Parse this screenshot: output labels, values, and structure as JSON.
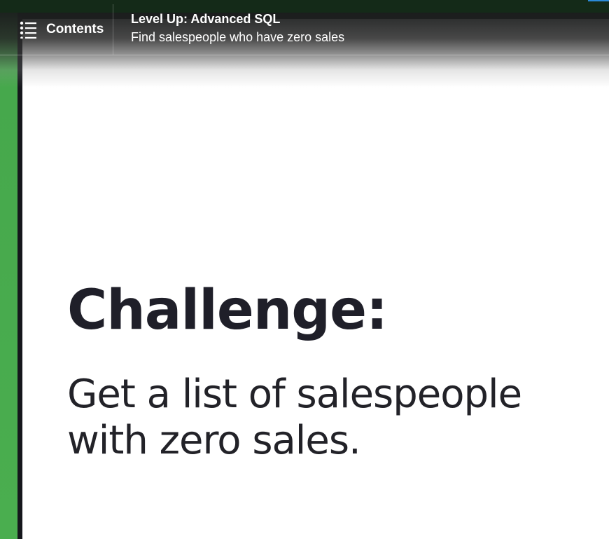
{
  "header": {
    "contents_label": "Contents",
    "course_title": "Level Up: Advanced SQL",
    "video_title": "Find salespeople who have zero sales"
  },
  "slide": {
    "heading": "Challenge:",
    "body_lines": [
      "Get a list of salespeople",
      "with zero sales."
    ]
  },
  "colors": {
    "desktop_green": "#4aae4f",
    "header_bg": "#1c1e1e",
    "slide_bg": "#ffffff",
    "slide_text": "#1f1f29",
    "accent": "#2b8ad8"
  },
  "icons": {
    "contents": "list-icon"
  }
}
